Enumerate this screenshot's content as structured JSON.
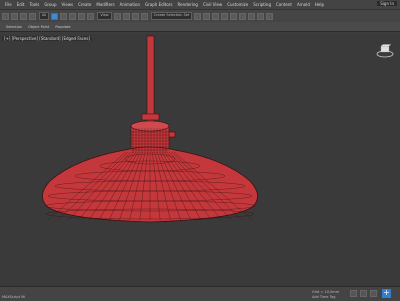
{
  "menu": {
    "items": [
      "File",
      "Edit",
      "Tools",
      "Group",
      "Views",
      "Create",
      "Modifiers",
      "Animation",
      "Graph Editors",
      "Rendering",
      "Civil View",
      "Customize",
      "Scripting",
      "Content",
      "Arnold",
      "Help"
    ],
    "signin": "Sign In"
  },
  "toolbar": {
    "filter": "All",
    "view": "View",
    "selection_set": "Create Selection Set"
  },
  "ribbon": {
    "items": [
      "Selection",
      "Object Paint",
      "Populate"
    ]
  },
  "viewport": {
    "label": "[+] [Perspective] [Standard] [Edged Faces]",
    "mesh_color": "#c4383c",
    "wire_color": "#3d1012",
    "background": "#3a3a3a"
  },
  "status": {
    "script": "MAXScript Mi",
    "grid": "Grid = 10,0mm",
    "time_tag": "Add Time Tag"
  }
}
